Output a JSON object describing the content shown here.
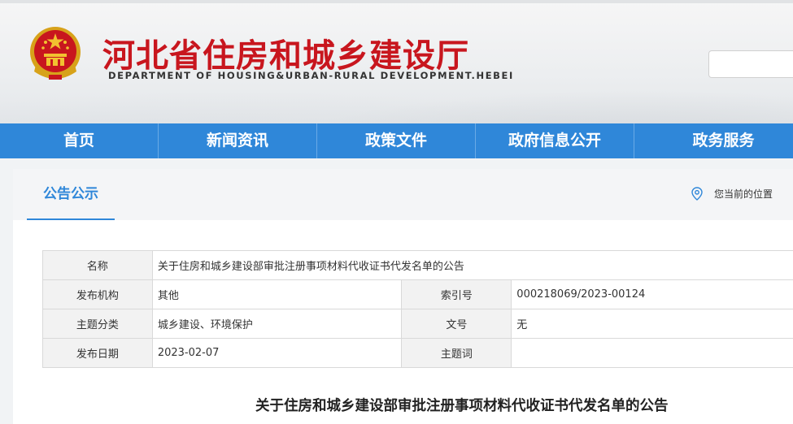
{
  "header": {
    "title": "河北省住房和城乡建设厅",
    "subtitle": "DEPARTMENT OF HOUSING&URBAN-RURAL DEVELOPMENT.HEBEI",
    "search_placeholder": ""
  },
  "nav": {
    "items": [
      "首页",
      "新闻资讯",
      "政策文件",
      "政府信息公开",
      "政务服务"
    ]
  },
  "section": {
    "tab": "公告公示",
    "location_label": "您当前的位置",
    "location_icon": "location-pin-icon"
  },
  "meta": {
    "name_label": "名称",
    "name_value": "关于住房和城乡建设部审批注册事项材料代收证书代发名单的公告",
    "publisher_label": "发布机构",
    "publisher_value": "其他",
    "index_label": "索引号",
    "index_value": "000218069/2023-00124",
    "topic_label": "主题分类",
    "topic_value": "城乡建设、环境保护",
    "docno_label": "文号",
    "docno_value": "无",
    "date_label": "发布日期",
    "date_value": "2023-02-07",
    "keywords_label": "主题词",
    "keywords_value": ""
  },
  "article": {
    "title": "关于住房和城乡建设部审批注册事项材料代收证书代发名单的公告"
  },
  "colors": {
    "brand_red": "#c8161e",
    "nav_blue": "#2f87d9"
  }
}
